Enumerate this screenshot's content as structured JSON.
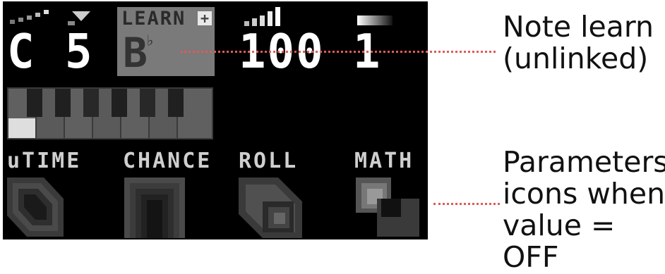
{
  "display": {
    "root_note": "C",
    "octave": "5",
    "learn": {
      "label": "LEARN",
      "plus": "+",
      "note": "B",
      "accidental": "♭"
    },
    "velocity": "100",
    "length": "1",
    "params": [
      {
        "label": "uTIME",
        "icon": "utime-icon"
      },
      {
        "label": "CHANCE",
        "icon": "chance-icon"
      },
      {
        "label": "ROLL",
        "icon": "roll-icon"
      },
      {
        "label": "MATH",
        "icon": "math-icon"
      }
    ]
  },
  "annotations": {
    "note_learn": [
      "Note learn",
      "(unlinked)"
    ],
    "params_off": [
      "Parameters",
      "icons when",
      "value = OFF"
    ]
  },
  "colors": {
    "annotation_line": "#e05a5a",
    "screen_bg": "#000000",
    "learn_bg": "#7a7a7a"
  }
}
